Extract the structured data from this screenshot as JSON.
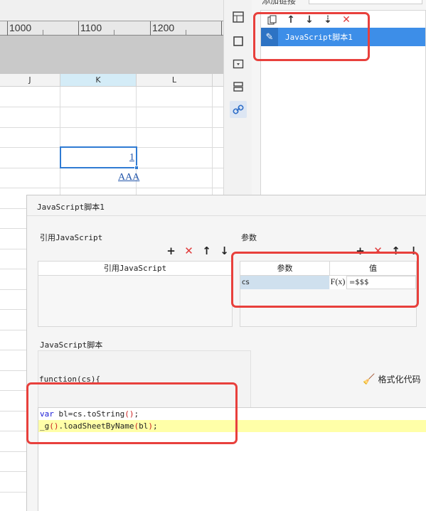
{
  "ruler": {
    "labels": [
      "1000",
      "1100",
      "1200"
    ]
  },
  "sheet": {
    "columns": [
      "J",
      "K",
      "L"
    ],
    "cells": {
      "k_value": "1",
      "k_link": "AAA"
    }
  },
  "side_panel": {
    "top_label": "添加链接",
    "tool_icons": [
      "copy-icon",
      "arrow-up-icon",
      "arrow-down-icon",
      "move-down-icon",
      "delete-icon"
    ],
    "list_item_label": "JavaScript脚本1"
  },
  "dialog": {
    "title": "JavaScript脚本1",
    "ref_section_label": "引用JavaScript",
    "ref_column_header": "引用JavaScript",
    "param_section_label": "参数",
    "param_headers": {
      "name": "参数",
      "value": "值"
    },
    "params": [
      {
        "name": "cs",
        "fx": "F(x)",
        "value": "=$$$"
      }
    ],
    "script_section_label": "JavaScript脚本",
    "function_signature": "function(cs){",
    "format_button_label": "格式化代码",
    "code": {
      "line1_kw": "var",
      "line1_rest": " bl=cs.toString",
      "line1_paren": "()",
      "line1_end": ";",
      "line2_a": "_g",
      "line2_paren1": "()",
      "line2_b": ".loadSheetByName",
      "line2_paren2_open": "(",
      "line2_arg": "bl",
      "line2_paren2_close": ")",
      "line2_end": ";"
    }
  },
  "colors": {
    "accent": "#3d8ee8",
    "annotation": "#e8403c",
    "highlight": "#ffffa8"
  }
}
